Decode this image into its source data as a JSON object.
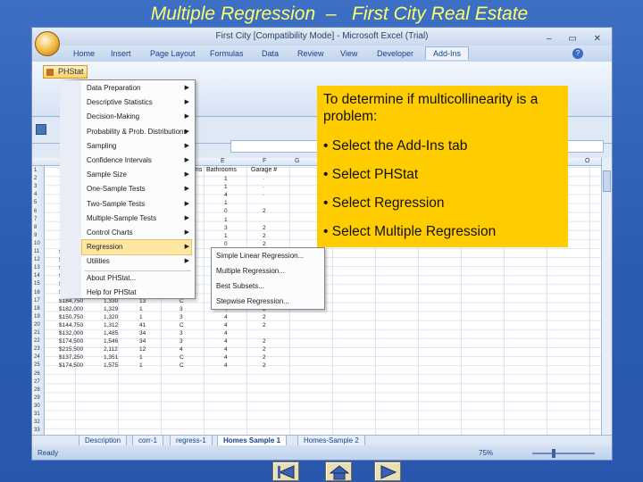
{
  "slide": {
    "title": "Multiple Regression  –   First City Real Estate"
  },
  "excel": {
    "window_title": "First City  [Compatibility Mode] - Microsoft Excel (Trial)",
    "window_controls": "–  ▭  ✕",
    "ribbon_tabs": [
      "Home",
      "Insert",
      "Page Layout",
      "Formulas",
      "Data",
      "Review",
      "View",
      "Developer",
      "Add-Ins"
    ],
    "active_tab": "Add-Ins",
    "phstat_button": "PHStat",
    "help_glyph": "?",
    "columns": [
      "E",
      "F",
      "G",
      "O"
    ],
    "partial_headers": [
      "ms",
      "Bathrooms",
      "Garage #"
    ],
    "row_numbers": [
      "1",
      "2",
      "3",
      "4",
      "5",
      "6",
      "7",
      "8",
      "9",
      "10",
      "11",
      "12",
      "13",
      "14",
      "15",
      "16",
      "17",
      "18",
      "19",
      "20",
      "21",
      "22",
      "23",
      "24",
      "25",
      "26",
      "27",
      "28",
      "29",
      "30",
      "31",
      "32",
      "33"
    ],
    "rows": [
      [
        "",
        "",
        "",
        "1",
        "·"
      ],
      [
        "",
        "",
        "",
        "1",
        "·"
      ],
      [
        "",
        "",
        "",
        "4",
        "·"
      ],
      [
        "",
        "",
        "",
        "1",
        ""
      ],
      [
        "",
        "",
        "",
        "0",
        "2"
      ],
      [
        "",
        "",
        "",
        "1",
        ""
      ],
      [
        "",
        "",
        "",
        "3",
        "2"
      ],
      [
        "",
        "",
        "",
        "1",
        "2"
      ],
      [
        "",
        "",
        "",
        "0",
        "2"
      ],
      [
        "$181,500",
        "1,332",
        "1",
        "3",
        "4",
        "2"
      ],
      [
        "$181,500",
        "1,134",
        "35",
        "C",
        "2",
        "2"
      ],
      [
        "$155,750",
        "1,370",
        "1",
        "4",
        "3",
        "2"
      ],
      [
        "$167,250",
        "1,352",
        "33",
        "C",
        "4",
        "2"
      ],
      [
        "$152,500",
        "1,340",
        "1",
        "3",
        "2",
        "2"
      ],
      [
        "$145,250",
        "1,335",
        "1",
        "3",
        "5",
        "2"
      ],
      [
        "$184,750",
        "1,330",
        "13",
        "C",
        "5",
        "2"
      ],
      [
        "$182,000",
        "1,329",
        "1",
        "3",
        "4",
        "2"
      ],
      [
        "$150,750",
        "1,320",
        "1",
        "3",
        "4",
        "2"
      ],
      [
        "$144,750",
        "1,312",
        "41",
        "C",
        "4",
        "2"
      ],
      [
        "$132,000",
        "1,485",
        "34",
        "3",
        "4",
        ""
      ],
      [
        "$174,500",
        "1,546",
        "34",
        "3",
        "4",
        "2"
      ],
      [
        "$215,500",
        "2,112",
        "12",
        "4",
        "4",
        "2"
      ],
      [
        "$137,250",
        "1,351",
        "1",
        "C",
        "4",
        "2"
      ],
      [
        "$174,500",
        "1,575",
        "1",
        "C",
        "4",
        "2"
      ]
    ],
    "sheet_tabs": [
      "Description",
      "corr-1",
      "regress-1",
      "Homes Sample 1",
      "Homes-Sample 2"
    ],
    "active_sheet": "Homes Sample 1",
    "status_left": "Ready",
    "zoom": "75%"
  },
  "menu": {
    "items": [
      {
        "label": "Data Preparation",
        "submenu": true
      },
      {
        "label": "Descriptive Statistics",
        "submenu": true
      },
      {
        "label": "Decision-Making",
        "submenu": true
      },
      {
        "label": "Probability & Prob. Distributions",
        "submenu": true
      },
      {
        "label": "Sampling",
        "submenu": true
      },
      {
        "label": "Confidence Intervals",
        "submenu": true
      },
      {
        "label": "Sample Size",
        "submenu": true
      },
      {
        "label": "One-Sample Tests",
        "submenu": true
      },
      {
        "label": "Two-Sample Tests",
        "submenu": true
      },
      {
        "label": "Multiple-Sample Tests",
        "submenu": true
      },
      {
        "label": "Control Charts",
        "submenu": true
      },
      {
        "label": "Regression",
        "submenu": true,
        "highlighted": true
      },
      {
        "label": "Utilities",
        "submenu": true
      },
      {
        "label": "About PHStat...",
        "submenu": false
      },
      {
        "label": "Help for PHStat",
        "submenu": false
      }
    ],
    "arrow_glyph": "▶"
  },
  "submenu": {
    "items": [
      "Simple Linear Regression...",
      "Multiple Regression...",
      "Best Subsets...",
      "Stepwise Regression..."
    ]
  },
  "callout": {
    "intro": "To determine if multicollinearity is a problem:",
    "bullets": [
      "• Select the Add-Ins tab",
      "• Select PHStat",
      "• Select Regression",
      "• Select Multiple Regression"
    ]
  },
  "colors": {
    "callout_bg": "#ffcc00",
    "title_color": "#ffff66",
    "slide_bg": "#2b5bb3"
  }
}
